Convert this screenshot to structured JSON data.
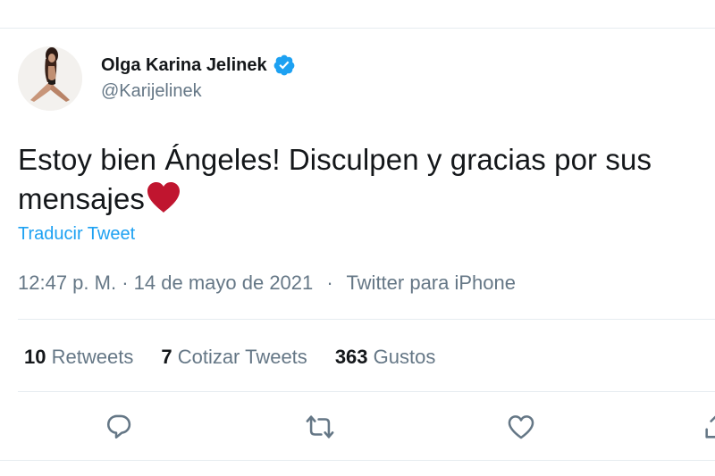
{
  "user": {
    "display_name": "Olga Karina Jelinek",
    "username": "@Karijelinek",
    "verified": true
  },
  "tweet": {
    "text": "Estoy bien Ángeles! Disculpen y gracias por sus mensajes",
    "emoji": "red-heart",
    "translate_label": "Traducir Tweet"
  },
  "meta": {
    "time": "12:47 p. M.",
    "date": "14 de mayo de 2021",
    "separator": "·",
    "source": "Twitter para iPhone"
  },
  "stats": {
    "retweets_count": "10",
    "retweets_label": "Retweets",
    "quotes_count": "7",
    "quotes_label": "Cotizar Tweets",
    "likes_count": "363",
    "likes_label": "Gustos"
  },
  "colors": {
    "link": "#1da1f2",
    "secondary_text": "#657786",
    "heart": "#c0152f",
    "verified_badge": "#1da1f2"
  },
  "icons": [
    "verified-badge-icon",
    "reply-icon",
    "retweet-icon",
    "like-icon",
    "share-icon"
  ]
}
